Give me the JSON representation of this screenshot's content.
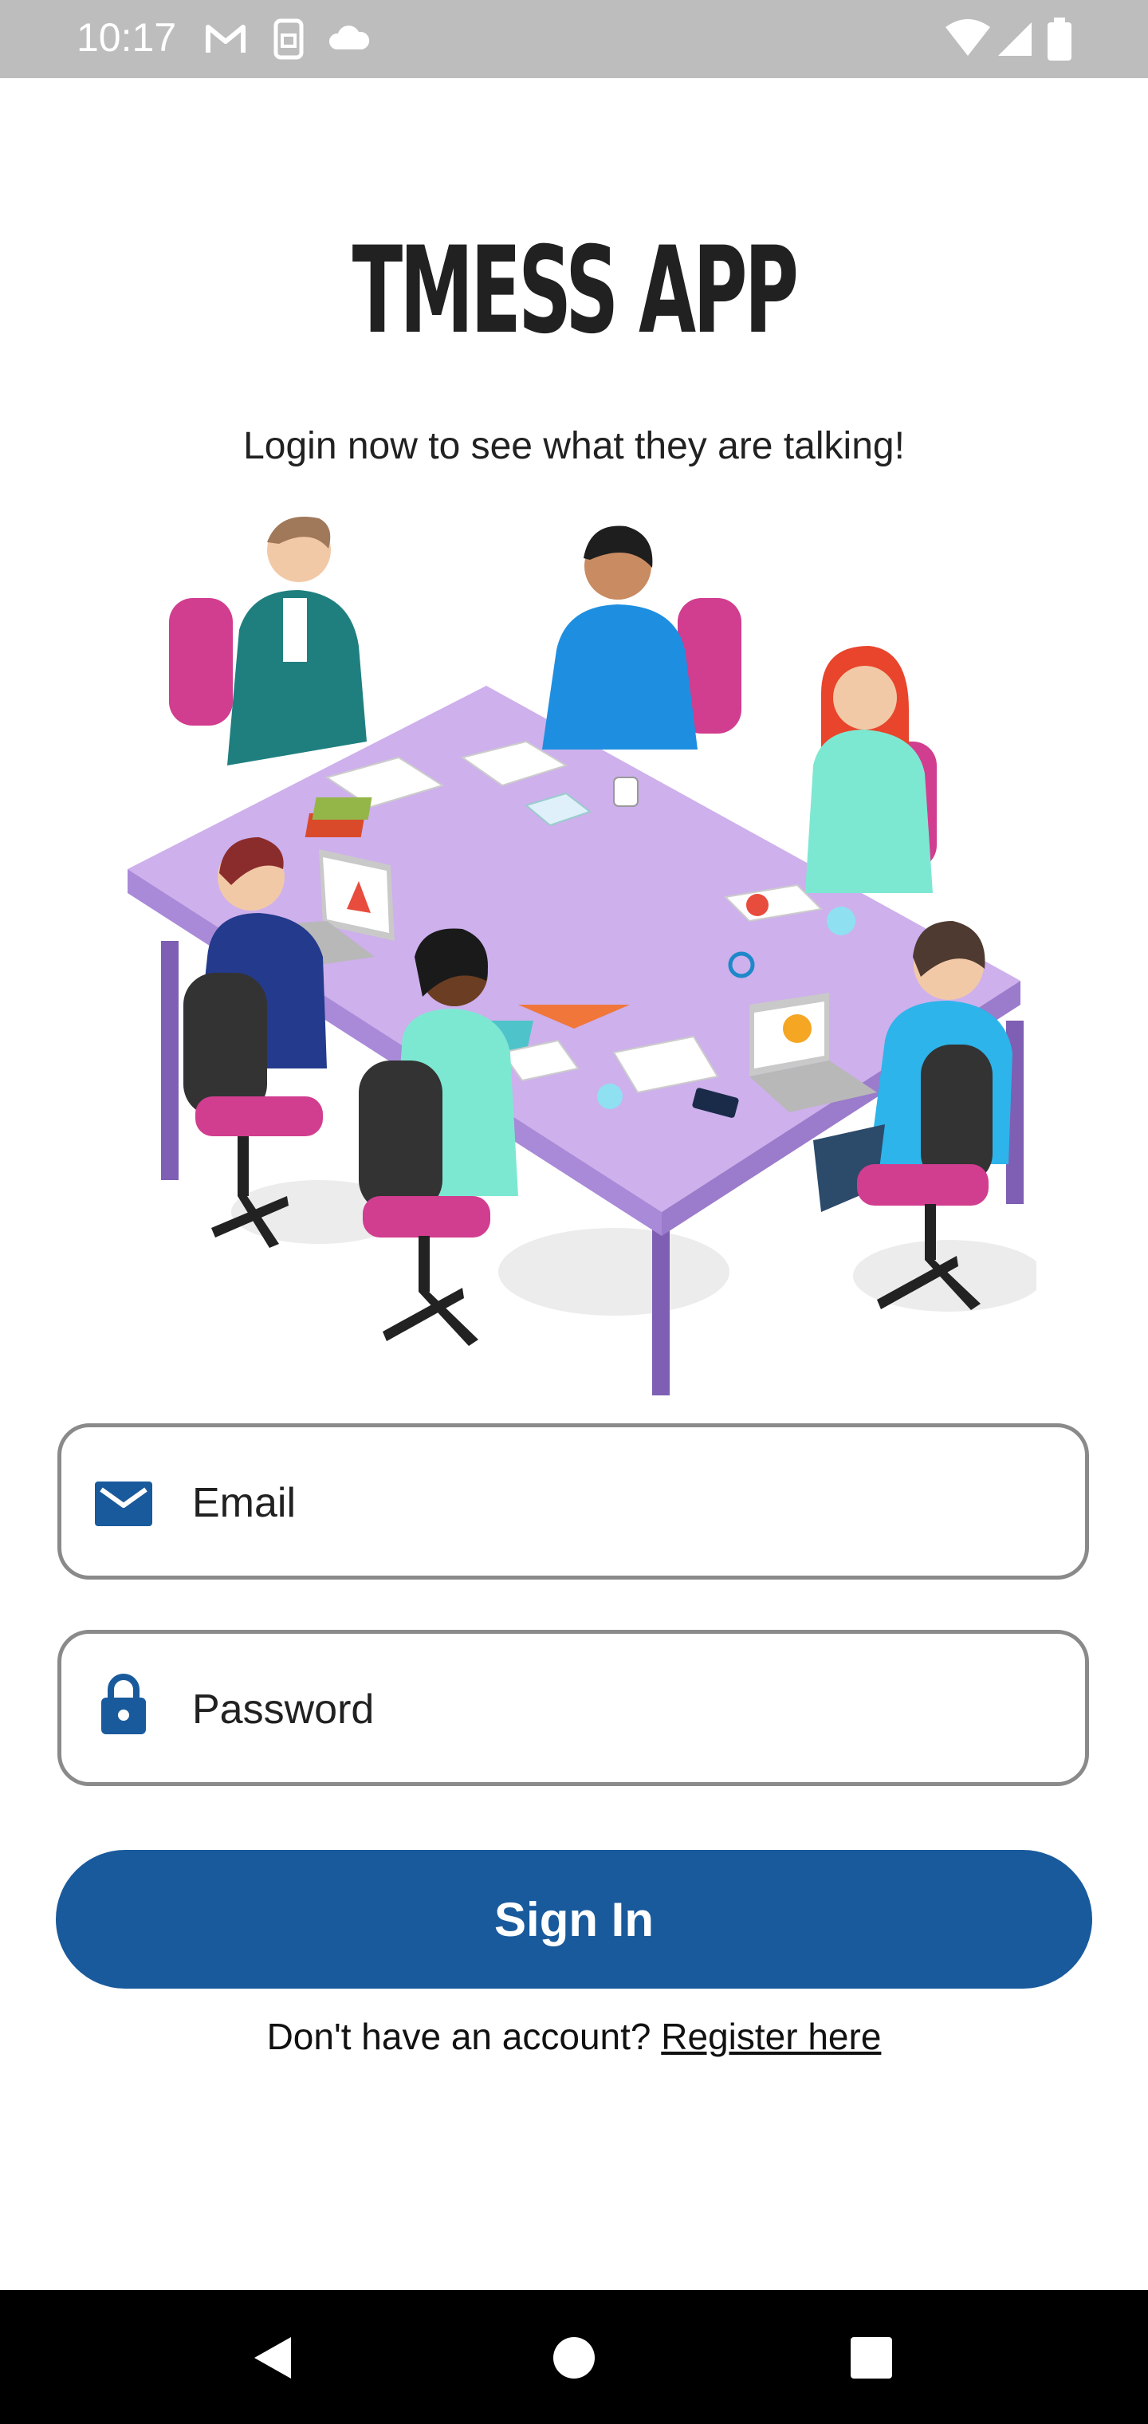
{
  "status_bar": {
    "time": "10:17",
    "left_icons": [
      "gmail-icon",
      "sim-icon",
      "cloud-icon"
    ],
    "right_icons": [
      "wifi-icon",
      "signal-icon",
      "battery-icon"
    ]
  },
  "header": {
    "title": "TMESS APP",
    "subtitle": "Login now to see what they are talking!"
  },
  "illustration": {
    "icon": "team-meeting-illustration"
  },
  "form": {
    "email": {
      "placeholder": "Email",
      "value": "",
      "icon": "email-icon"
    },
    "password": {
      "placeholder": "Password",
      "value": "",
      "icon": "lock-icon"
    },
    "sign_in_label": "Sign In",
    "register_prompt": "Don't have an account?",
    "register_link": "Register here"
  },
  "nav_bar": {
    "buttons": [
      "back-icon",
      "home-icon",
      "recents-icon"
    ]
  },
  "colors": {
    "primary": "#195A9C",
    "status_bar": "#BDBDBD",
    "nav_bar": "#000000",
    "table": "#CDB0EC"
  }
}
